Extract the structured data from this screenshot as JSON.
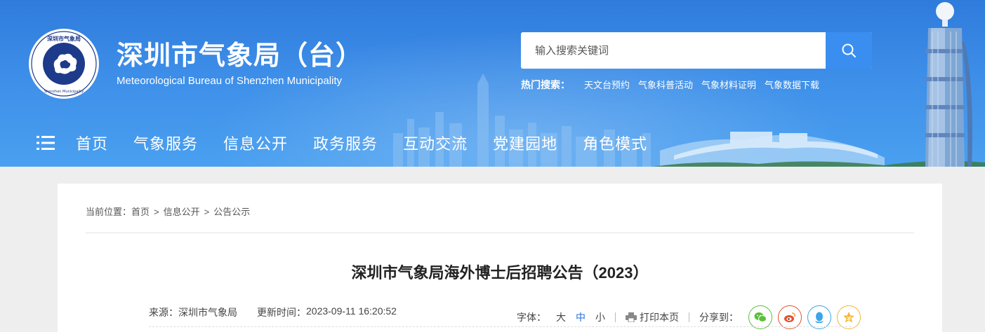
{
  "header": {
    "title": "深圳市气象局（台）",
    "subtitle": "Meteorological Bureau of Shenzhen Municipality",
    "emblem_top_text": "深圳市气象局",
    "emblem_ring_text": "Meteorological Bureau of Shenzhen Municipality",
    "search": {
      "placeholder": "输入搜索关键词"
    },
    "hot_search": {
      "label": "热门搜索：",
      "items": [
        "天文台预约",
        "气象科普活动",
        "气象材料证明",
        "气象数据下载"
      ]
    },
    "nav": [
      "首页",
      "气象服务",
      "信息公开",
      "政务服务",
      "互动交流",
      "党建园地",
      "角色模式"
    ]
  },
  "breadcrumb": {
    "prefix": "当前位置：",
    "items": [
      "首页",
      "信息公开",
      "公告公示"
    ]
  },
  "article": {
    "title": "深圳市气象局海外博士后招聘公告（2023）",
    "source_label": "来源：",
    "source": "深圳市气象局",
    "updated_label": "更新时间：",
    "updated": "2023-09-11 16:20:52"
  },
  "tools": {
    "font_label": "字体：",
    "font_sizes": [
      "大",
      "中",
      "小"
    ],
    "print": "打印本页",
    "share_label": "分享到："
  },
  "colors": {
    "header_blue": "#2f7bdc",
    "search_button": "#3a8ef0",
    "wechat": "#5cbf3c",
    "weibo": "#e6502f",
    "qq": "#3aa6e8",
    "qzone": "#f2b632"
  }
}
